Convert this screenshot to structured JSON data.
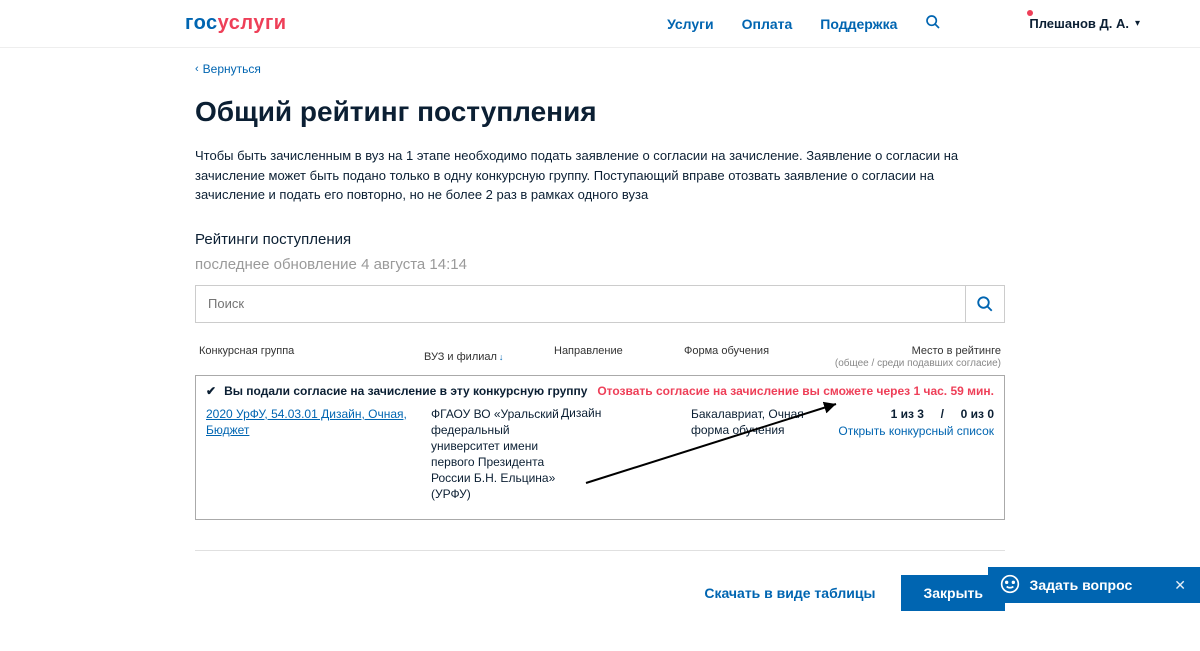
{
  "header": {
    "logo_part1": "гос",
    "logo_part2": "услуги",
    "nav": {
      "services": "Услуги",
      "pay": "Оплата",
      "support": "Поддержка"
    },
    "user_name": "Плешанов Д. А."
  },
  "back_label": "Вернуться",
  "page_title": "Общий рейтинг поступления",
  "intro": "Чтобы быть зачисленным в вуз на 1 этапе необходимо подать заявление о согласии на зачисление. Заявление о согласии на зачисление может быть подано только в одну конкурсную группу. Поступающий вправе отозвать заявление о согласии на зачисление и подать его повторно, но не более 2 раз в рамках одного вуза",
  "subheading": "Рейтинги поступления",
  "updated": "последнее обновление 4 августа 14:14",
  "search": {
    "placeholder": "Поиск"
  },
  "table": {
    "headers": {
      "group": "Конкурсная группа",
      "vuz": "ВУЗ и филиал",
      "dir": "Направление",
      "form": "Форма обучения",
      "place": "Место в рейтинге",
      "place_sub": "(общее / среди подавших согласие)"
    },
    "consent_given": "Вы подали согласие на зачисление в эту конкурсную группу",
    "withdraw_msg": "Отозвать согласие на зачисление вы сможете через 1 час. 59 мин.",
    "row": {
      "group": "2020 УрФУ, 54.03.01 Дизайн, Очная, Бюджет",
      "vuz": "ФГАОУ ВО «Уральский федеральный университет имени первого Президента России Б.Н. Ельцина» (УРФУ)",
      "dir": "Дизайн",
      "form": "Бакалавриат, Очная форма обучения",
      "place_general": "1 из 3",
      "place_sep": "/",
      "place_consent": "0 из 0",
      "open_list": "Открыть конкурсный список"
    }
  },
  "download": "Скачать в виде таблицы",
  "close": "Закрыть",
  "chat": {
    "label": "Задать вопрос"
  }
}
